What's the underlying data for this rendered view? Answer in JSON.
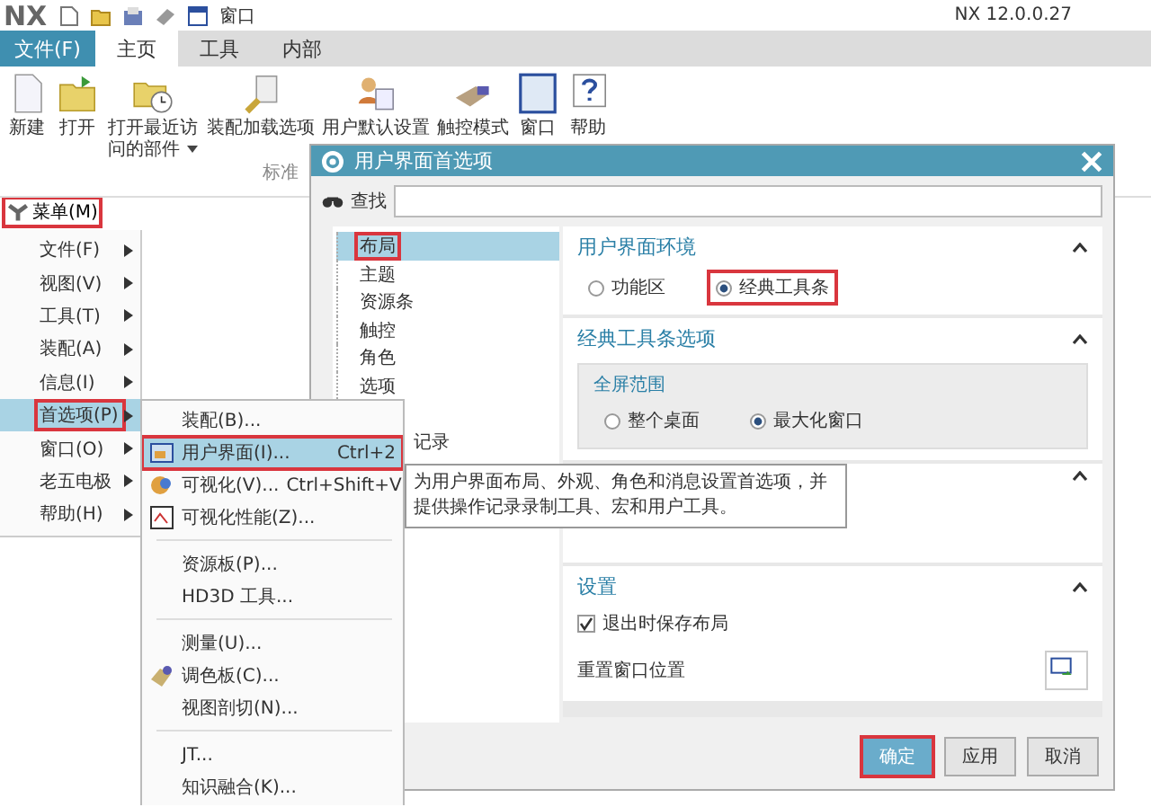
{
  "app": {
    "logo": "NX",
    "window_menu": "窗口",
    "version": "NX 12.0.0.27"
  },
  "tabs": [
    {
      "label": "文件(F)",
      "kind": "file",
      "selected": false
    },
    {
      "label": "主页",
      "kind": "tab",
      "selected": true
    },
    {
      "label": "工具",
      "kind": "tab",
      "selected": false
    },
    {
      "label": "内部",
      "kind": "tab",
      "selected": false
    }
  ],
  "ribbon": {
    "buttons": [
      {
        "label": "新建"
      },
      {
        "label": "打开"
      },
      {
        "label": "打开最近访问的部件",
        "dropdown": true
      },
      {
        "label": "装配加载选项"
      },
      {
        "label": "用户默认设置"
      },
      {
        "label": "触控模式"
      },
      {
        "label": "窗口"
      },
      {
        "label": "帮助"
      }
    ],
    "group_label": "标准"
  },
  "menu_button": {
    "label": "菜单(M)",
    "marked": true
  },
  "main_menu": [
    {
      "label": "文件(F)",
      "selected": false,
      "marked": false
    },
    {
      "label": "视图(V)",
      "selected": false,
      "marked": false
    },
    {
      "label": "工具(T)",
      "selected": false,
      "marked": false
    },
    {
      "label": "装配(A)",
      "selected": false,
      "marked": false
    },
    {
      "label": "信息(I)",
      "selected": false,
      "marked": false
    },
    {
      "label": "首选项(P)",
      "selected": true,
      "marked": true
    },
    {
      "label": "窗口(O)",
      "selected": false,
      "marked": false
    },
    {
      "label": "老五电极",
      "selected": false,
      "marked": false
    },
    {
      "label": "帮助(H)",
      "selected": false,
      "marked": false
    }
  ],
  "submenu": [
    {
      "kind": "item",
      "label": "装配(B)...",
      "selected": false,
      "marked": false
    },
    {
      "kind": "item",
      "label": "用户界面(I)...",
      "shortcut": "Ctrl+2",
      "selected": true,
      "marked": true
    },
    {
      "kind": "item",
      "label": "可视化(V)...",
      "shortcut": "Ctrl+Shift+V",
      "selected": false,
      "marked": false
    },
    {
      "kind": "item",
      "label": "可视化性能(Z)...",
      "selected": false,
      "marked": false
    },
    {
      "kind": "separator"
    },
    {
      "kind": "item",
      "label": "资源板(P)...",
      "selected": false,
      "marked": false
    },
    {
      "kind": "item",
      "label": "HD3D 工具...",
      "selected": false,
      "marked": false
    },
    {
      "kind": "separator"
    },
    {
      "kind": "item",
      "label": "测量(U)...",
      "selected": false,
      "marked": false
    },
    {
      "kind": "item",
      "label": "调色板(C)...",
      "selected": false,
      "marked": false
    },
    {
      "kind": "item",
      "label": "视图剖切(N)...",
      "selected": false,
      "marked": false
    },
    {
      "kind": "separator"
    },
    {
      "kind": "item",
      "label": "JT...",
      "selected": false,
      "marked": false
    },
    {
      "kind": "item",
      "label": "知识融合(K)...",
      "selected": false,
      "marked": false
    }
  ],
  "tooltip": "为用户界面布局、外观、角色和消息设置首选项，并提供操作记录录制工具、宏和用户工具。",
  "dialog": {
    "title": "用户界面首选项",
    "search_label": "查找",
    "tree": [
      {
        "label": "布局",
        "selected": true,
        "marked": true
      },
      {
        "label": "主题",
        "selected": false,
        "marked": false
      },
      {
        "label": "资源条",
        "selected": false,
        "marked": false
      },
      {
        "label": "触控",
        "selected": false,
        "marked": false
      },
      {
        "label": "角色",
        "selected": false,
        "marked": false
      },
      {
        "label": "选项",
        "selected": false,
        "marked": false
      },
      {
        "label": "记录",
        "kind": "partial",
        "selected": false,
        "marked": false
      }
    ],
    "sections": [
      {
        "title": "用户界面环境",
        "expanded": true,
        "radios": [
          {
            "label": "功能区",
            "selected": false,
            "marked": false
          },
          {
            "label": "经典工具条",
            "selected": true,
            "marked": true
          }
        ]
      },
      {
        "title": "经典工具条选项",
        "expanded": true,
        "group": {
          "title": "全屏范围",
          "radios": [
            {
              "label": "整个桌面",
              "selected": false,
              "marked": false
            },
            {
              "label": "最大化窗口",
              "selected": true,
              "marked": false
            }
          ]
        }
      },
      {
        "expanded": true
      },
      {
        "title": "设置",
        "expanded": true,
        "checkbox": {
          "label": "退出时保存布局",
          "checked": true
        },
        "reset_label": "重置窗口位置"
      }
    ],
    "buttons": [
      {
        "label": "确定",
        "kind": "primary",
        "marked": true
      },
      {
        "label": "应用",
        "kind": "normal",
        "marked": false
      },
      {
        "label": "取消",
        "kind": "normal",
        "marked": false
      }
    ]
  }
}
